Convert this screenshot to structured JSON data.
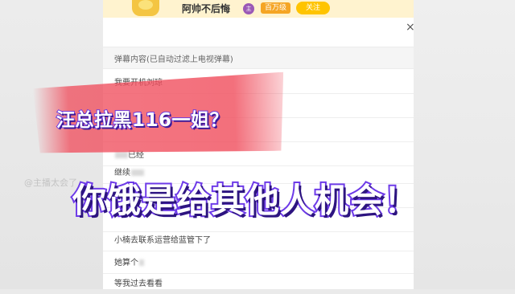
{
  "header": {
    "streamer_name": "阿帅不后悔",
    "level_badge": "主",
    "fans_badge": "百万级",
    "follow_label": "关注",
    "close_label": "×"
  },
  "danmaku_list": {
    "title": "弹幕内容(已自动过滤上电视弹幕)",
    "items": [
      {
        "text": "我要开机刘琼",
        "obscured": false
      },
      {
        "text": "已经",
        "obscured": true
      },
      {
        "text": "继续",
        "obscured": true
      },
      {
        "text": "小楠去联系运营给蓝管下了",
        "obscured": false
      },
      {
        "text": "她算个",
        "obscured": true
      },
      {
        "text": "等我过去看看",
        "obscured": false
      }
    ]
  },
  "overlay": {
    "title_top": "汪总拉黑116一姐？",
    "title_main": "你饿是给其他人机会！",
    "watermark": "@主播太会了",
    "banner_color": "#f0505f",
    "stroke_color": "#6d3ae8"
  }
}
